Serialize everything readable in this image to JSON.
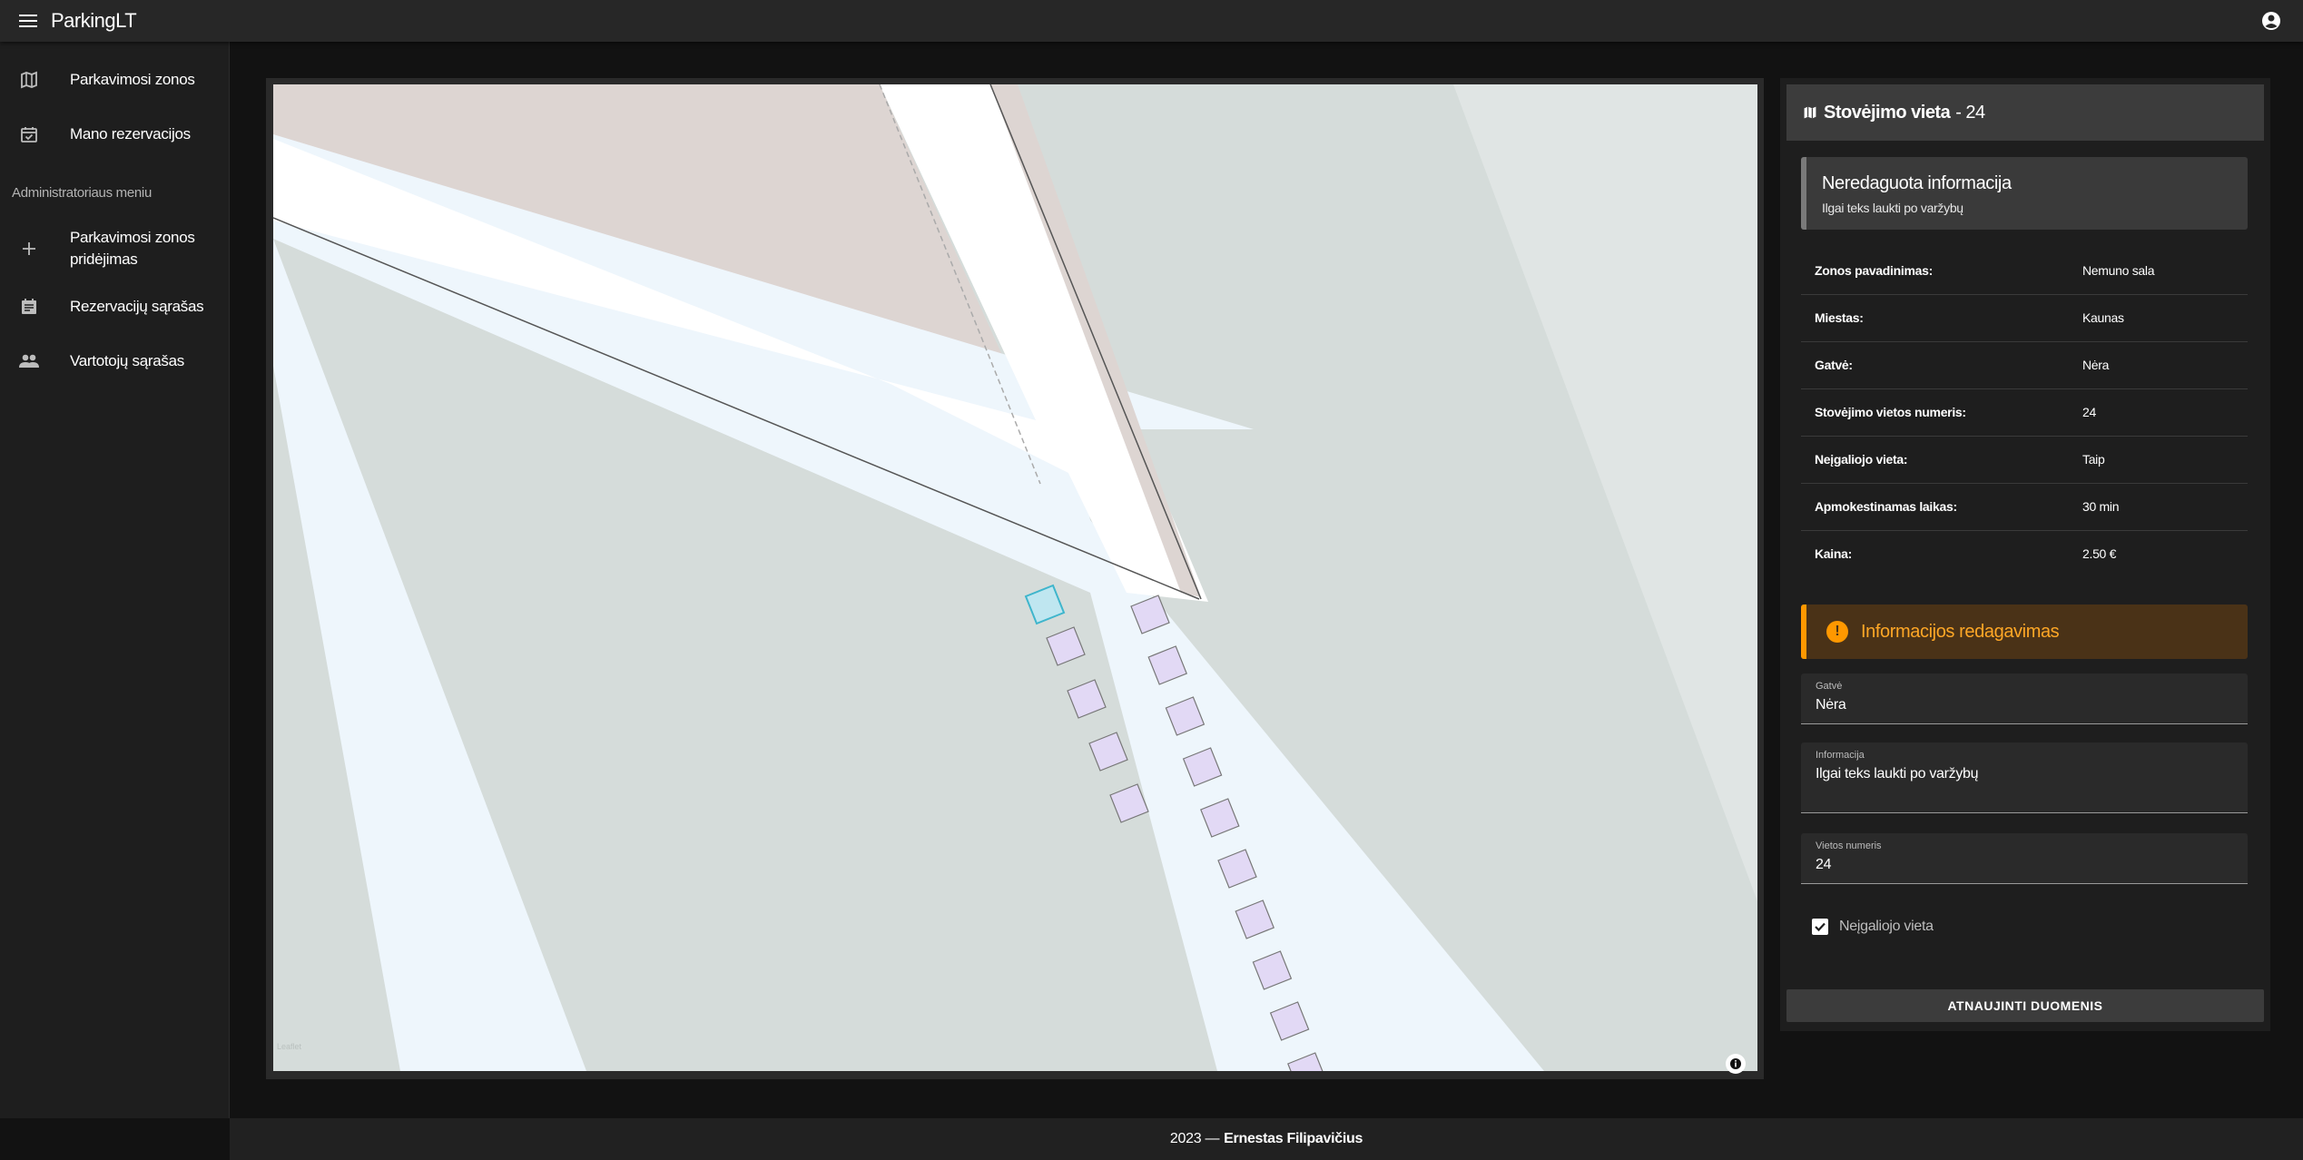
{
  "app": {
    "title": "ParkingLT"
  },
  "icons": {
    "menu": "menu-icon",
    "account": "account-circle-icon",
    "zones": "map-icon",
    "reservations": "event-available-icon",
    "add": "plus-icon",
    "reservation_list": "event-note-icon",
    "users": "group-icon",
    "info": "info-icon",
    "warning": "exclamation-icon",
    "check": "check-icon"
  },
  "sidebar": {
    "items": [
      {
        "label": "Parkavimosi zonos"
      },
      {
        "label": "Mano rezervacijos"
      }
    ],
    "admin_header": "Administratoriaus meniu",
    "admin_items": [
      {
        "label_line1": "Parkavimosi zonos",
        "label_line2": "pridėjimas"
      },
      {
        "label": "Rezervacijų sąrašas"
      },
      {
        "label": "Vartotojų sąrašas"
      }
    ]
  },
  "panel": {
    "title_bold": "Stovėjimo vieta",
    "title_rest": "- 24",
    "info_alert": {
      "title": "Neredaguota informacija",
      "text": "Ilgai teks laukti po varžybų"
    },
    "details": [
      {
        "key": "Zonos pavadinimas:",
        "value": "Nemuno sala"
      },
      {
        "key": "Miestas:",
        "value": "Kaunas"
      },
      {
        "key": "Gatvė:",
        "value": "Nėra"
      },
      {
        "key": "Stovėjimo vietos numeris:",
        "value": "24"
      },
      {
        "key": "Neįgaliojo vieta:",
        "value": "Taip"
      },
      {
        "key": "Apmokestinamas laikas:",
        "value": "30 min"
      },
      {
        "key": "Kaina:",
        "value": "2.50 €"
      }
    ],
    "edit_alert": "Informacijos redagavimas",
    "form": {
      "street_label": "Gatvė",
      "street_value": "Nėra",
      "info_label": "Informacija",
      "info_value": "Ilgai teks laukti po varžybų",
      "number_label": "Vietos numeris",
      "number_value": "24",
      "disabled_label": "Neįgaliojo vieta",
      "disabled_checked": true
    },
    "submit_label": "ATNAUJINTI DUOMENIS"
  },
  "map": {
    "attribution": "Leaflet",
    "colors": {
      "land": "#d5dcda",
      "road": "#ffffff",
      "path": "#eef6fc",
      "building": "#ddd5d2",
      "spot": "#e2d9f5",
      "selected": "#bfe6f0"
    }
  },
  "footer": {
    "year": "2023 —",
    "author": "Ernestas Filipavičius"
  }
}
